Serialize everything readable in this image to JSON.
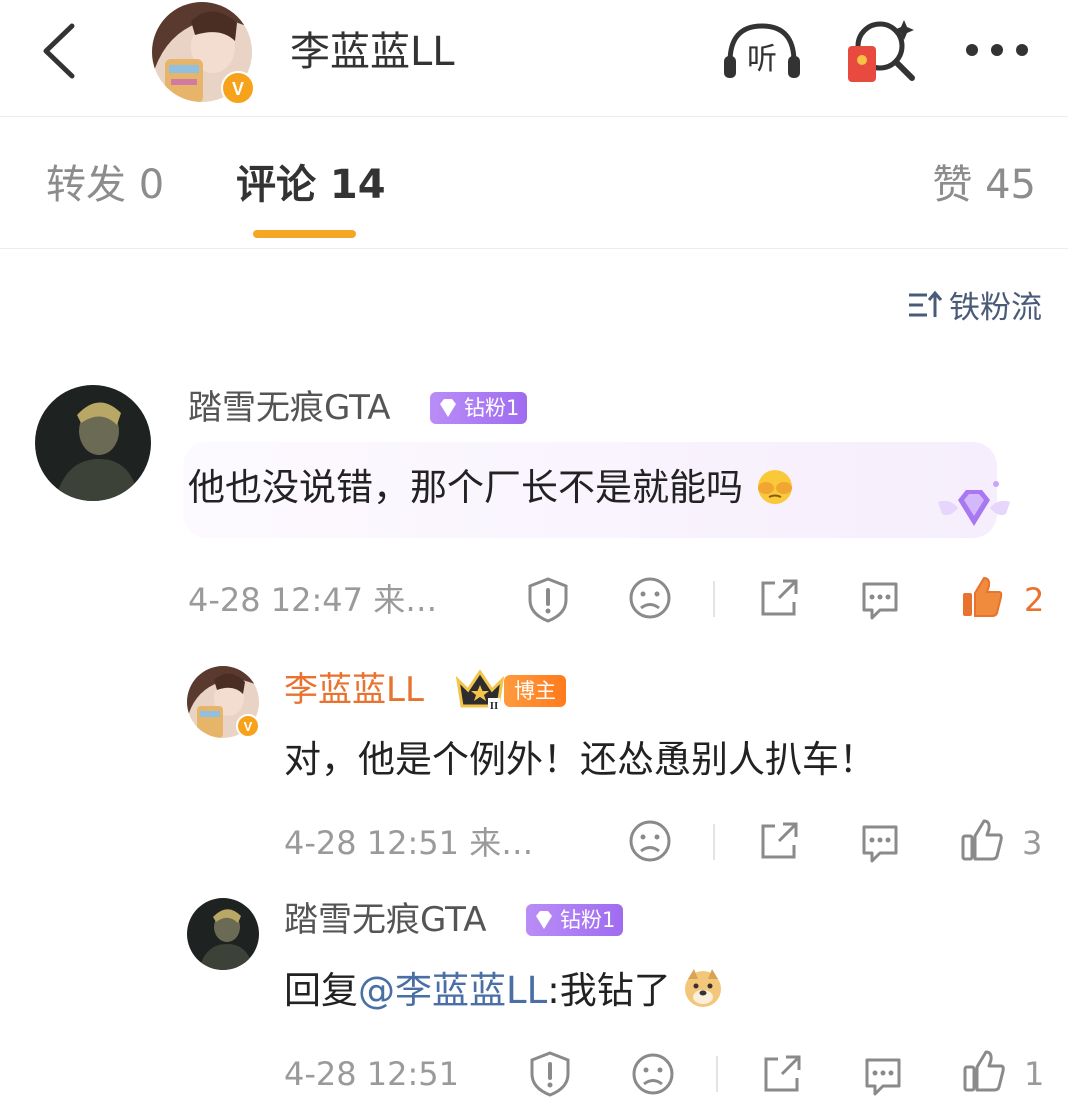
{
  "header": {
    "title": "李蓝蓝LL",
    "listen_label": "听"
  },
  "tabs": [
    {
      "label": "转发 0"
    },
    {
      "label": "评论 14"
    },
    {
      "label": "赞 45"
    }
  ],
  "sort": {
    "label": "铁粉流"
  },
  "comments": [
    {
      "user": "踏雪无痕GTA",
      "badge": "钻粉1",
      "text": "他也没说错，那个厂长不是就能吗",
      "time": "4-28 12:47  来…",
      "likes": "2"
    },
    {
      "user": "李蓝蓝LL",
      "badge": "博主",
      "text": "对，他是个例外！还怂恿别人扒车！",
      "time": "4-28 12:51  来…",
      "likes": "3"
    },
    {
      "user": "踏雪无痕GTA",
      "badge": "钻粉1",
      "text_prefix": "回复",
      "mention": "@李蓝蓝LL",
      "text_suffix": ":我钻了",
      "time": "4-28 12:51",
      "likes": "1"
    }
  ],
  "colors": {
    "accent": "#f5a623",
    "author": "#e8722e",
    "mention": "#4a6fa5",
    "fan_badge": "#a877f2"
  }
}
